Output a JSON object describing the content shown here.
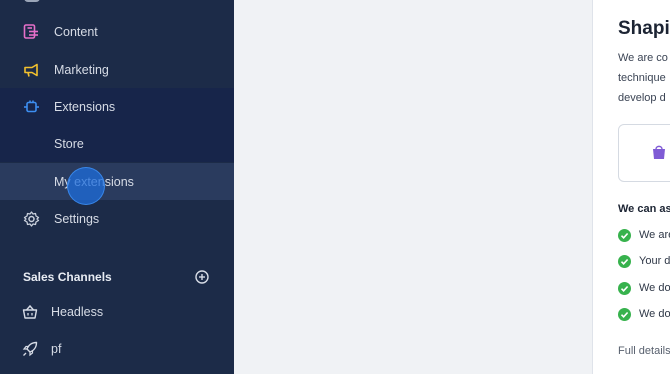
{
  "sidebar": {
    "items": [
      {
        "label": "Content",
        "icon": "content-icon"
      },
      {
        "label": "Marketing",
        "icon": "megaphone-icon"
      },
      {
        "label": "Extensions",
        "icon": "plug-icon"
      },
      {
        "label": "Store"
      },
      {
        "label": "My extensions"
      },
      {
        "label": "Settings",
        "icon": "gear-icon"
      }
    ],
    "sales_channels": {
      "title": "Sales Channels",
      "add_icon": "plus-circle-icon",
      "items": [
        {
          "label": "Headless",
          "icon": "basket-icon"
        },
        {
          "label": "pf",
          "icon": "rocket-icon"
        }
      ]
    }
  },
  "panel": {
    "title": "Shapi",
    "intro_lines": [
      "We are co",
      "technique",
      "develop d"
    ],
    "assist_title": "We can as",
    "checks": [
      "We are",
      "Your d",
      "We do",
      "We do"
    ],
    "footer": "Full details"
  },
  "colors": {
    "sidebar_bg": "#1c2b48",
    "content_icon": "#e56fc9",
    "marketing_icon": "#f2c12e",
    "extensions_icon": "#3d8ef0",
    "check": "#37b24d",
    "bag": "#7f5bd5"
  }
}
